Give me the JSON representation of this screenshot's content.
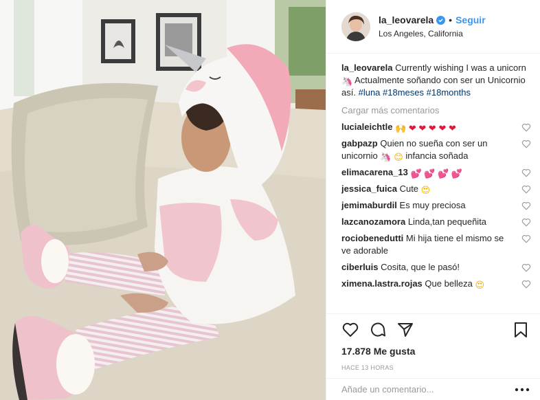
{
  "post": {
    "username": "la_leovarela",
    "follow_label": "Seguir",
    "separator": "•",
    "location": "Los Angeles, California",
    "caption": {
      "text1": "Currently wishing I was a unicorn",
      "text2": "Actualmente soñando con ser un Unicornio así.",
      "hashtags": [
        "#luna",
        "#18meses",
        "#18months"
      ]
    },
    "load_more": "Cargar más comentarios",
    "likes": "17.878 Me gusta",
    "time": "HACE 13 HORAS",
    "comment_placeholder": "Añade un comentario...",
    "icons": {
      "like": "heart-outline-icon",
      "comment": "speech-bubble-icon",
      "share": "paper-plane-icon",
      "save": "bookmark-icon",
      "more": "ellipsis-icon",
      "verified": "verified-badge-icon"
    },
    "colors": {
      "link": "#3897f0",
      "hashtag": "#003569",
      "muted": "#999999",
      "verified": "#3897f0",
      "heart": "#e4163a"
    }
  },
  "comments": [
    {
      "user": "lucialeichtle",
      "text": "",
      "emoji": [
        "🙌",
        "❤",
        "❤",
        "❤",
        "❤",
        "❤"
      ]
    },
    {
      "user": "gabpazp",
      "text": "Quien no sueña con ser un unicornio",
      "emoji": [
        "🦄",
        "😊"
      ],
      "text_after": "infancia soñada"
    },
    {
      "user": "elimacarena_13",
      "text": "",
      "emoji": [
        "💕",
        "💕",
        "💕",
        "💕"
      ]
    },
    {
      "user": "jessica_fuica",
      "text": "Cute",
      "emoji": [
        "😍"
      ]
    },
    {
      "user": "jemimaburdil",
      "text": "Es muy preciosa",
      "emoji": []
    },
    {
      "user": "lazcanozamora",
      "text": "Linda,tan pequeñita",
      "emoji": []
    },
    {
      "user": "rociobenedutti",
      "text": "Mi hija tiene el mismo se ve adorable",
      "emoji": []
    },
    {
      "user": "ciberluis",
      "text": "Cosita, que le pasó!",
      "emoji": []
    },
    {
      "user": "ximena.lastra.rojas",
      "text": "Que belleza",
      "emoji": [
        "😍"
      ]
    }
  ]
}
